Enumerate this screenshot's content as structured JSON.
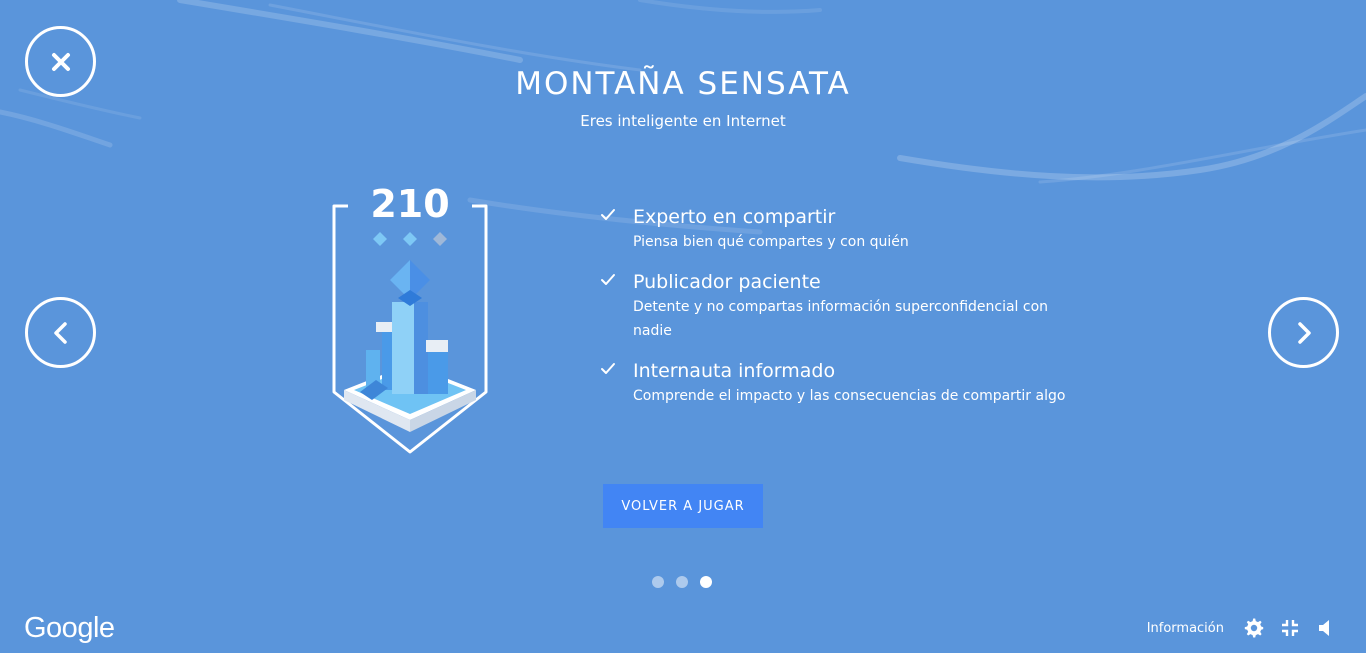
{
  "colors": {
    "background": "#5a95db",
    "button": "#4285f4",
    "text": "#ffffff"
  },
  "header": {
    "title": "MONTAÑA SENSATA",
    "subtitle": "Eres inteligente en Internet"
  },
  "badge": {
    "score": "210"
  },
  "achievements": [
    {
      "icon": "check-icon",
      "title": "Experto en compartir",
      "description": "Piensa bien qué compartes y con quién"
    },
    {
      "icon": "check-icon",
      "title": "Publicador paciente",
      "description": "Detente y no compartas información superconfidencial con nadie"
    },
    {
      "icon": "check-icon",
      "title": "Internauta informado",
      "description": "Comprende el impacto y las consecuencias de compartir algo"
    }
  ],
  "actions": {
    "replay_label": "VOLVER A JUGAR"
  },
  "navigation": {
    "close_icon": "close-icon",
    "prev_icon": "chevron-left-icon",
    "next_icon": "chevron-right-icon"
  },
  "pagination": {
    "total": 3,
    "active_index": 3
  },
  "footer": {
    "logo": "Google",
    "info_label": "Información",
    "icons": [
      "gear-icon",
      "exit-fullscreen-icon",
      "volume-icon"
    ]
  }
}
